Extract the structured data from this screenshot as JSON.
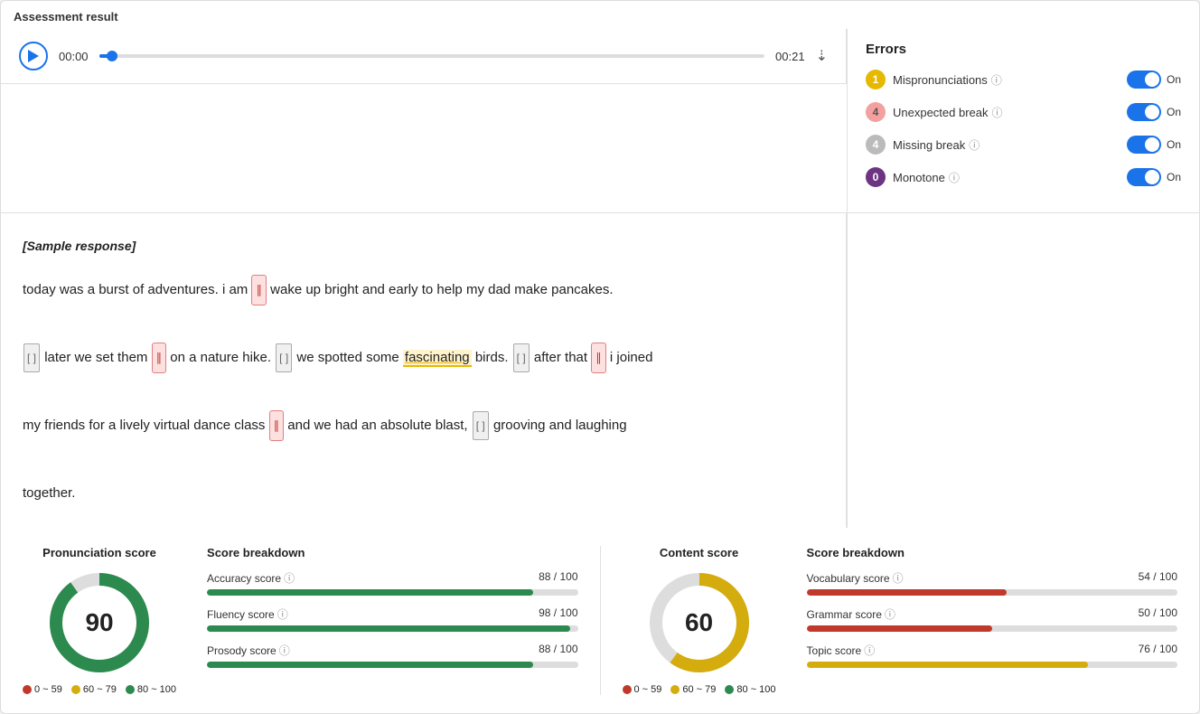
{
  "page": {
    "title": "Assessment result"
  },
  "audio": {
    "time_start": "00:00",
    "time_end": "00:21"
  },
  "errors": {
    "title": "Errors",
    "items": [
      {
        "count": "1",
        "label": "Mispronunciations",
        "toggle": "On",
        "badge_class": "badge-yellow"
      },
      {
        "count": "4",
        "label": "Unexpected break",
        "toggle": "On",
        "badge_class": "badge-pink"
      },
      {
        "count": "4",
        "label": "Missing break",
        "toggle": "On",
        "badge_class": "badge-gray"
      },
      {
        "count": "0",
        "label": "Monotone",
        "toggle": "On",
        "badge_class": "badge-zero"
      }
    ]
  },
  "text_content": {
    "header": "[Sample response]",
    "paragraph": "today was a burst of adventures. i am wake up bright and early to help my dad make pancakes. later we set them on a nature hike. we spotted some fascinating birds. after that i joined my friends for a lively virtual dance class and we had an absolute blast, grooving and laughing together."
  },
  "pronunciation": {
    "title": "Pronunciation score",
    "score": "90",
    "donut_green_pct": 90,
    "legend": [
      {
        "label": "0 ~ 59",
        "color": "#c0392b"
      },
      {
        "label": "60 ~ 79",
        "color": "#d4ac0d"
      },
      {
        "label": "80 ~ 100",
        "color": "#2d8a4e"
      }
    ],
    "breakdown_title": "Score breakdown",
    "breakdown": [
      {
        "label": "Accuracy score",
        "value": "88 / 100",
        "pct": 88,
        "color": "#2d8a4e"
      },
      {
        "label": "Fluency score",
        "value": "98 / 100",
        "pct": 98,
        "color": "#2d8a4e"
      },
      {
        "label": "Prosody score",
        "value": "88 / 100",
        "pct": 88,
        "color": "#2d8a4e"
      }
    ]
  },
  "content": {
    "title": "Content score",
    "score": "60",
    "donut_yellow_pct": 60,
    "legend": [
      {
        "label": "0 ~ 59",
        "color": "#c0392b"
      },
      {
        "label": "60 ~ 79",
        "color": "#d4ac0d"
      },
      {
        "label": "80 ~ 100",
        "color": "#2d8a4e"
      }
    ],
    "breakdown_title": "Score breakdown",
    "breakdown": [
      {
        "label": "Vocabulary score",
        "value": "54 / 100",
        "pct": 54,
        "color": "#c0392b"
      },
      {
        "label": "Grammar score",
        "value": "50 / 100",
        "pct": 50,
        "color": "#c0392b"
      },
      {
        "label": "Topic score",
        "value": "76 / 100",
        "pct": 76,
        "color": "#d4ac0d"
      }
    ]
  }
}
